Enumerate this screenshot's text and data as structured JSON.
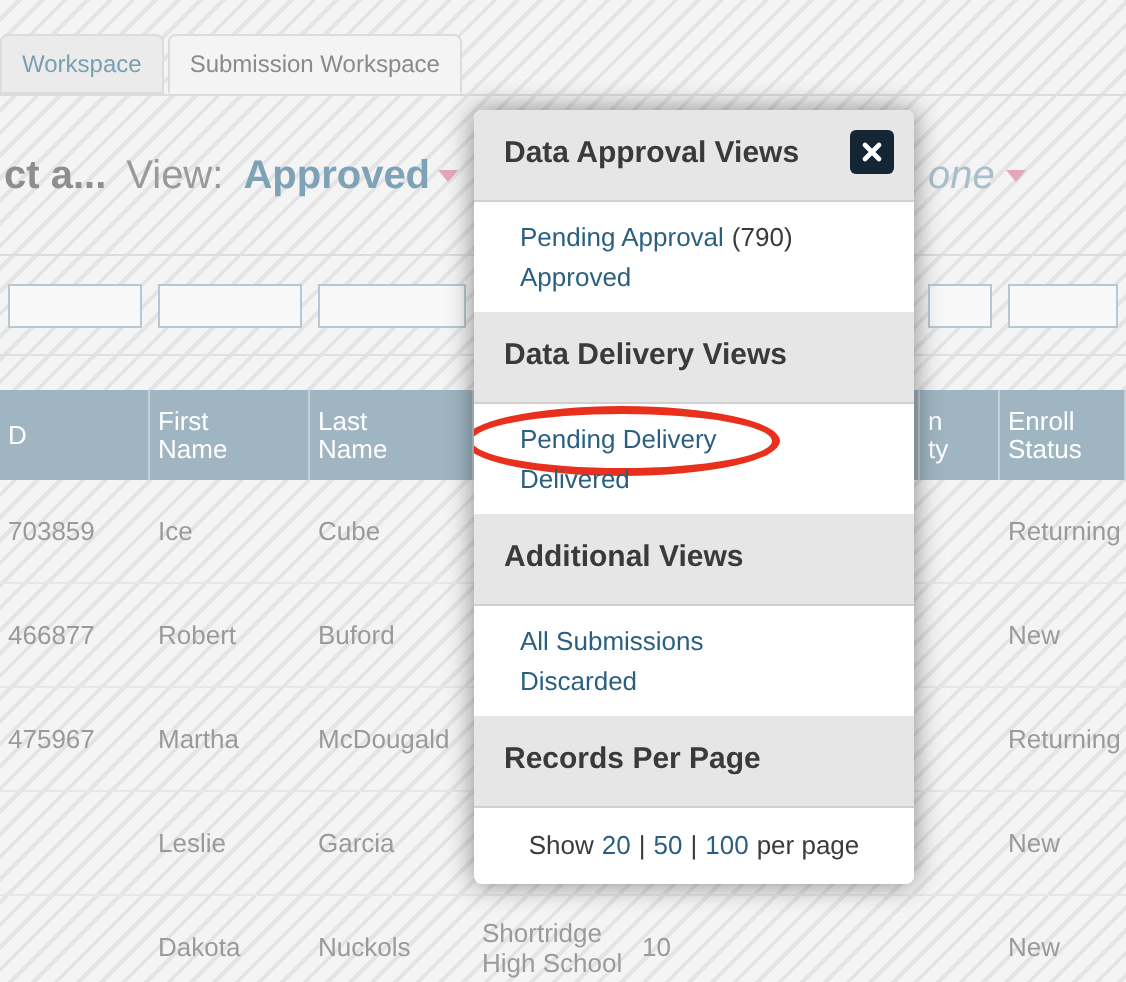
{
  "tabs": [
    {
      "label": "Workspace",
      "selected": false
    },
    {
      "label": "Submission Workspace",
      "selected": true
    }
  ],
  "view_bar": {
    "title": "ct a...",
    "label": "View:",
    "value": "Approved",
    "column_2_value": "one"
  },
  "table": {
    "headers": {
      "column_1": [
        "D"
      ],
      "first_name": [
        "First",
        "Name"
      ],
      "last_name": [
        "Last",
        "Name"
      ],
      "column_6": [
        "n",
        "ty"
      ],
      "enroll_status": [
        "Enroll",
        "Status"
      ]
    },
    "rows": [
      {
        "column_1": "703859",
        "first_name": "Ice",
        "last_name": "Cube",
        "enroll_status": "Returning"
      },
      {
        "column_1": "466877",
        "first_name": "Robert",
        "last_name": "Buford",
        "enroll_status": "New"
      },
      {
        "column_1": "475967",
        "first_name": "Martha",
        "last_name": "McDougald",
        "enroll_status": "Returning"
      },
      {
        "first_name": "Leslie",
        "last_name": "Garcia",
        "enroll_status": "New"
      },
      {
        "first_name": "Dakota",
        "last_name": "Nuckols",
        "column_4": "Shortridge High School",
        "column_5": "10",
        "enroll_status": "New"
      }
    ]
  },
  "popup": {
    "sections": [
      {
        "title": "Data Approval Views",
        "items": [
          {
            "text": "Pending Approval",
            "count": "(790)"
          },
          {
            "text": "Approved"
          }
        ]
      },
      {
        "title": "Data Delivery Views",
        "items": [
          {
            "text": "Pending Delivery",
            "highlighted": true
          },
          {
            "text": "Delivered",
            "highlighted": false
          }
        ]
      },
      {
        "title": "Additional Views",
        "items": [
          {
            "text": "All Submissions"
          },
          {
            "text": "Discarded"
          }
        ]
      },
      {
        "title": "Records Per Page",
        "footer": [
          {
            "kind": "text",
            "text": "Show"
          },
          {
            "kind": "link",
            "text": "20"
          },
          {
            "kind": "text",
            "text": "|"
          },
          {
            "kind": "link",
            "text": "50"
          },
          {
            "kind": "text",
            "text": "|"
          },
          {
            "kind": "link",
            "text": "100"
          },
          {
            "kind": "text",
            "text": "per page"
          }
        ]
      }
    ]
  }
}
